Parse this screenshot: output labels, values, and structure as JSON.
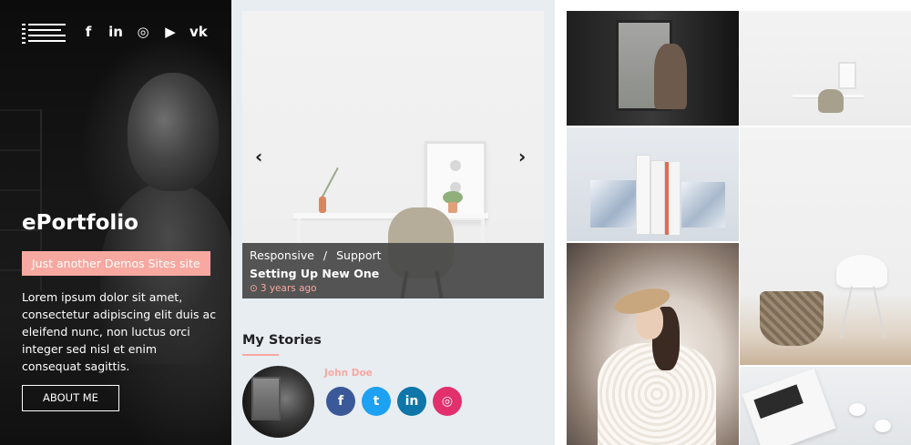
{
  "sidebar": {
    "social_icons": [
      {
        "icon": "facebook-icon",
        "glyph": "f"
      },
      {
        "icon": "linkedin-icon",
        "glyph": "in"
      },
      {
        "icon": "instagram-icon",
        "glyph": "◎"
      },
      {
        "icon": "youtube-icon",
        "glyph": "▶"
      },
      {
        "icon": "vk-icon",
        "glyph": "vk"
      }
    ],
    "site_title": "ePortfolio",
    "tagline": "Just another Demos Sites site",
    "intro": "Lorem ipsum dolor sit amet, consectetur adipiscing elit duis ac eleifend nunc, non luctus orci integer sed nisl et enim consequat sagittis.",
    "about_label": "ABOUT ME"
  },
  "slider": {
    "prev_glyph": "‹",
    "next_glyph": "›",
    "categories": [
      "Responsive",
      "Support"
    ],
    "category_separator": "/",
    "title": "Setting Up New One",
    "meta_icon": "clock-icon",
    "meta_glyph": "⊙",
    "date": "3 years ago"
  },
  "stories": {
    "heading": "My Stories",
    "author": "John Doe",
    "social": [
      {
        "icon": "facebook-icon",
        "glyph": "f",
        "color": "#3b5998"
      },
      {
        "icon": "twitter-icon",
        "glyph": "t",
        "color": "#1da1f2"
      },
      {
        "icon": "linkedin-icon",
        "glyph": "in",
        "color": "#0e76a8"
      },
      {
        "icon": "instagram-icon",
        "glyph": "◎",
        "color": "#e1306c"
      }
    ]
  },
  "colors": {
    "accent": "#f7a8a0",
    "sidebar_bg": "#111111",
    "middle_bg": "#e8edf2"
  }
}
